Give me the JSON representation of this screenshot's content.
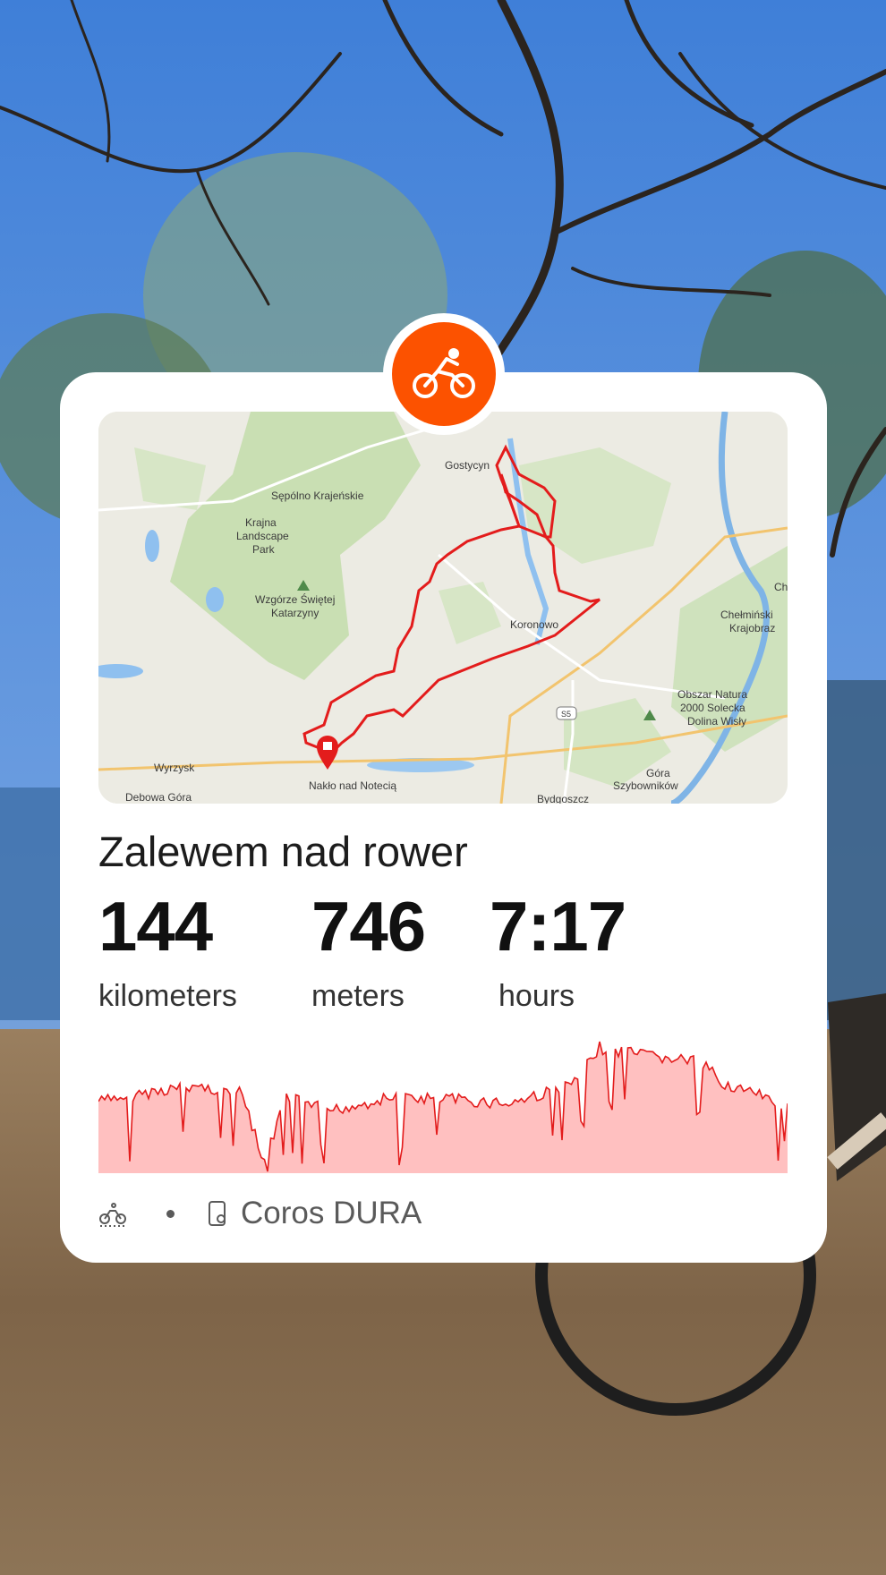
{
  "app": {
    "brand_color": "#fc5200",
    "activity_icon": "cycling-icon"
  },
  "map": {
    "route_color": "#e31c1c",
    "place_labels": [
      "Gostycyn",
      "Sępólno Krajeńskie",
      "Krajna",
      "Landscape",
      "Park",
      "Wzgórze Świętej",
      "Katarzyny",
      "Koronowo",
      "Ch",
      "Chełmiński",
      "Krajobraz",
      "Obszar Natura",
      "2000 Solecka",
      "Dolina Wisły",
      "Wyrzysk",
      "Debowa Góra",
      "Nakło nad Notecią",
      "Bydgoszcz",
      "Góra",
      "Szybowników",
      "S5"
    ]
  },
  "activity": {
    "title": "Zalewem nad rower",
    "stats": [
      {
        "value": "144",
        "label": "kilometers"
      },
      {
        "value": "746",
        "label": "meters"
      },
      {
        "value": "7:17",
        "label": "hours"
      }
    ]
  },
  "elevation": {
    "fill_color": "#ffc0c0",
    "line_color": "#e31c1c"
  },
  "footer": {
    "sport_icon": "bike-icon",
    "device_icon": "watch-icon",
    "device": "Coros DURA"
  }
}
